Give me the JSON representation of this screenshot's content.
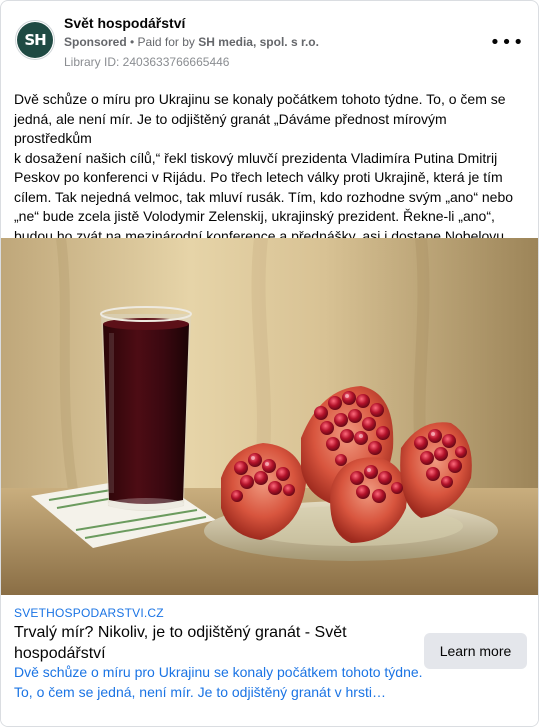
{
  "post": {
    "page_name": "Svět hospodářství",
    "avatar_initials": "SH",
    "sponsored_label": "Sponsored",
    "paid_for_prefix": "• Paid for by",
    "advertiser": "SH media, spol. s r.o.",
    "library_id": "Library ID: 2403633766665446",
    "more_icon": "ellipsis-horizontal-icon",
    "body_lines": [
      "Dvě schůze o míru pro Ukrajinu se konaly počátkem tohoto týdne. To, o čem se",
      "jedná, ale není mír. Je to odjištěný granát „Dáváme přednost mírovým prostředkům",
      "k dosažení našich cílů,“ řekl tiskový mluvčí prezidenta Vladimíra Putina Dmitrij",
      "Peskov po konferenci v Rijádu. Po třech letech války proti Ukrajině, která je tím",
      "cílem. Tak nejedná velmoc, tak mluví rusák. Tím, kdo rozhodne svým „ano“ nebo",
      "„ne“ bude zcela jistě Volodymir Zelenskij, ukrajinský prezident. Řekne-li „ano“,",
      "budou ho zvát na mezinárodní konference a přednášky, asi i dostane Nobelovu…"
    ]
  },
  "link": {
    "domain": "SVETHOSPODARSTVI.CZ",
    "title_lines": [
      "Trvalý mír? Nikoliv, je to odjištěný granát - Svět",
      "hospodářství"
    ],
    "description_lines": [
      "Dvě schůze o míru pro Ukrajinu se konaly počátkem tohoto týdne.",
      "To, o čem se jedná, není mír. Je to odjištěný granát v hrsti…"
    ],
    "cta_label": "Learn more"
  },
  "colors": {
    "link_blue": "#1b74e4",
    "secondary_text": "#65676b",
    "button_bg": "#e4e6eb",
    "avatar_bg": "#1f4a43"
  }
}
